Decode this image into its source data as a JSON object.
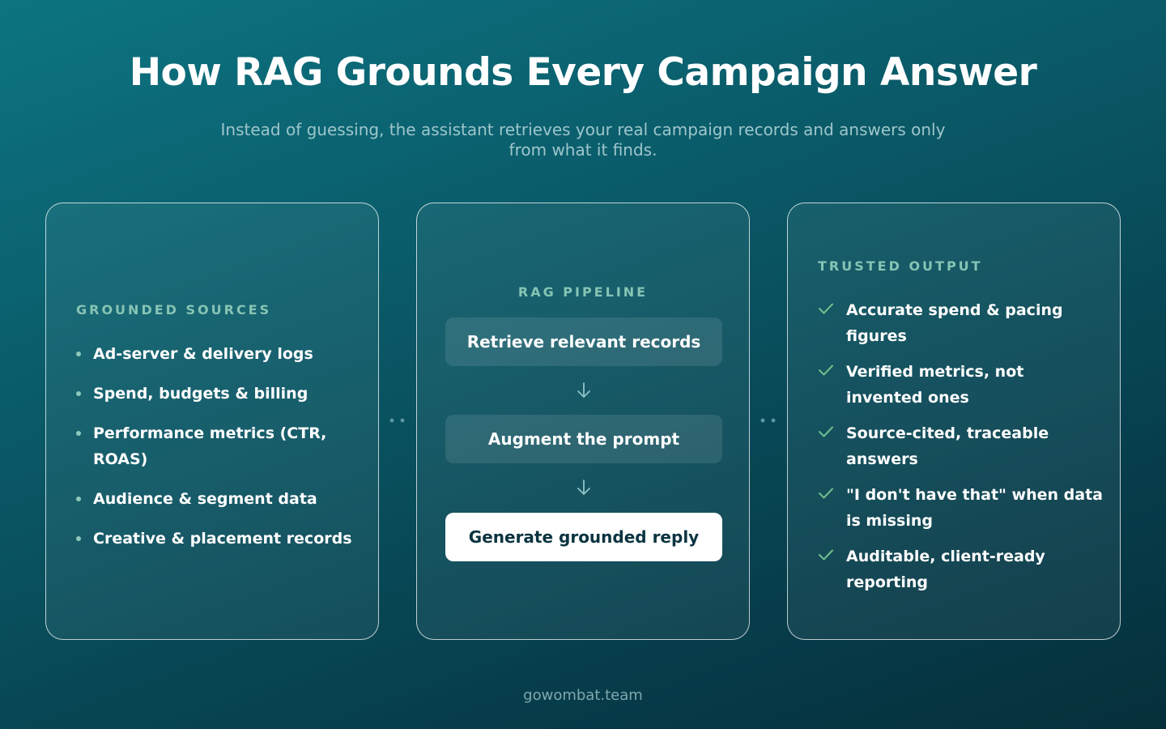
{
  "header": {
    "title": "How RAG Grounds Every Campaign Answer",
    "subtitle": "Instead of guessing, the assistant retrieves your real campaign records and answers only from what it finds."
  },
  "sources": {
    "label": "GROUNDED SOURCES",
    "items": [
      "Ad-server & delivery logs",
      "Spend, budgets & billing",
      "Performance metrics (CTR, ROAS)",
      "Audience & segment data",
      "Creative & placement records"
    ]
  },
  "pipeline": {
    "label": "RAG PIPELINE",
    "steps": [
      "Retrieve relevant records",
      "Augment the prompt",
      "Generate grounded reply"
    ]
  },
  "output": {
    "label": "TRUSTED OUTPUT",
    "items": [
      "Accurate spend & pacing figures",
      "Verified metrics, not invented ones",
      "Source-cited, traceable answers",
      "\"I don't have that\" when data is missing",
      "Auditable, client-ready reporting"
    ]
  },
  "footer": {
    "text": "gowombat.team"
  },
  "colors": {
    "accent_label": "#86c4b4",
    "check": "#6fc08e",
    "highlight_step_bg": "#ffffff",
    "highlight_step_text": "#0a3440"
  },
  "icons": {
    "bullet": "dot-icon",
    "step_arrow": "arrow-down-icon",
    "output_mark": "check-icon",
    "connector": "connector-dots-icon"
  }
}
